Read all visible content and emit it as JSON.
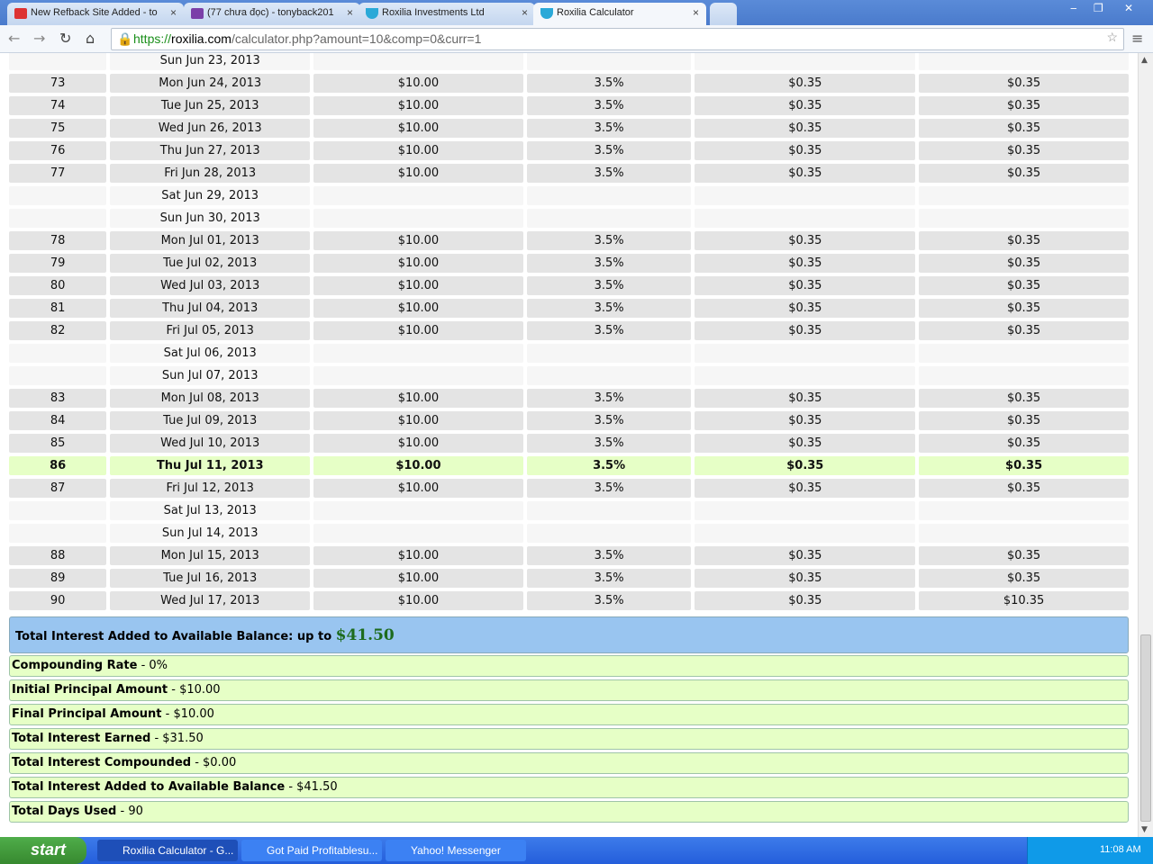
{
  "browser": {
    "tabs": [
      {
        "label": "New Refback Site Added - to",
        "icon": "gmail-icon"
      },
      {
        "label": "(77 chưa đọc) - tonyback201",
        "icon": "mail-icon"
      },
      {
        "label": "Roxilia Investments Ltd",
        "icon": "shield-icon"
      },
      {
        "label": "Roxilia Calculator",
        "icon": "shield-icon"
      }
    ],
    "url_scheme": "https://",
    "url_domain": "roxilia.com",
    "url_path": "/calculator.php?amount=10&comp=0&curr=1"
  },
  "table": {
    "rows": [
      [
        "",
        "Sun Jun 23, 2013",
        "",
        "",
        "",
        ""
      ],
      [
        "73",
        "Mon Jun 24, 2013",
        "$10.00",
        "3.5%",
        "$0.35",
        "$0.35"
      ],
      [
        "74",
        "Tue Jun 25, 2013",
        "$10.00",
        "3.5%",
        "$0.35",
        "$0.35"
      ],
      [
        "75",
        "Wed Jun 26, 2013",
        "$10.00",
        "3.5%",
        "$0.35",
        "$0.35"
      ],
      [
        "76",
        "Thu Jun 27, 2013",
        "$10.00",
        "3.5%",
        "$0.35",
        "$0.35"
      ],
      [
        "77",
        "Fri Jun 28, 2013",
        "$10.00",
        "3.5%",
        "$0.35",
        "$0.35"
      ],
      [
        "",
        "Sat Jun 29, 2013",
        "",
        "",
        "",
        ""
      ],
      [
        "",
        "Sun Jun 30, 2013",
        "",
        "",
        "",
        ""
      ],
      [
        "78",
        "Mon Jul 01, 2013",
        "$10.00",
        "3.5%",
        "$0.35",
        "$0.35"
      ],
      [
        "79",
        "Tue Jul 02, 2013",
        "$10.00",
        "3.5%",
        "$0.35",
        "$0.35"
      ],
      [
        "80",
        "Wed Jul 03, 2013",
        "$10.00",
        "3.5%",
        "$0.35",
        "$0.35"
      ],
      [
        "81",
        "Thu Jul 04, 2013",
        "$10.00",
        "3.5%",
        "$0.35",
        "$0.35"
      ],
      [
        "82",
        "Fri Jul 05, 2013",
        "$10.00",
        "3.5%",
        "$0.35",
        "$0.35"
      ],
      [
        "",
        "Sat Jul 06, 2013",
        "",
        "",
        "",
        ""
      ],
      [
        "",
        "Sun Jul 07, 2013",
        "",
        "",
        "",
        ""
      ],
      [
        "83",
        "Mon Jul 08, 2013",
        "$10.00",
        "3.5%",
        "$0.35",
        "$0.35"
      ],
      [
        "84",
        "Tue Jul 09, 2013",
        "$10.00",
        "3.5%",
        "$0.35",
        "$0.35"
      ],
      [
        "85",
        "Wed Jul 10, 2013",
        "$10.00",
        "3.5%",
        "$0.35",
        "$0.35"
      ],
      [
        "86",
        "Thu Jul 11, 2013",
        "$10.00",
        "3.5%",
        "$0.35",
        "$0.35"
      ],
      [
        "87",
        "Fri Jul 12, 2013",
        "$10.00",
        "3.5%",
        "$0.35",
        "$0.35"
      ],
      [
        "",
        "Sat Jul 13, 2013",
        "",
        "",
        "",
        ""
      ],
      [
        "",
        "Sun Jul 14, 2013",
        "",
        "",
        "",
        ""
      ],
      [
        "88",
        "Mon Jul 15, 2013",
        "$10.00",
        "3.5%",
        "$0.35",
        "$0.35"
      ],
      [
        "89",
        "Tue Jul 16, 2013",
        "$10.00",
        "3.5%",
        "$0.35",
        "$0.35"
      ],
      [
        "90",
        "Wed Jul 17, 2013",
        "$10.00",
        "3.5%",
        "$0.35",
        "$10.35"
      ]
    ],
    "highlighted_day": "86"
  },
  "total": {
    "label": "Total Interest Added to Available Balance: up to",
    "value": "$41.50"
  },
  "summary": [
    {
      "label": "Compounding Rate",
      "value": " - 0%"
    },
    {
      "label": "Initial Principal Amount",
      "value": " - $10.00"
    },
    {
      "label": "Final Principal Amount",
      "value": " - $10.00"
    },
    {
      "label": "Total Interest Earned",
      "value": " - $31.50"
    },
    {
      "label": "Total Interest Compounded",
      "value": " - $0.00"
    },
    {
      "label": "Total Interest Added to Available Balance",
      "value": " - $41.50"
    },
    {
      "label": "Total Days Used",
      "value": " - 90"
    }
  ],
  "taskbar": {
    "start": "start",
    "tasks": [
      "Roxilia Calculator - G...",
      "Got Paid Profitablesu...",
      "Yahoo! Messenger"
    ],
    "clock": "11:08 AM"
  }
}
